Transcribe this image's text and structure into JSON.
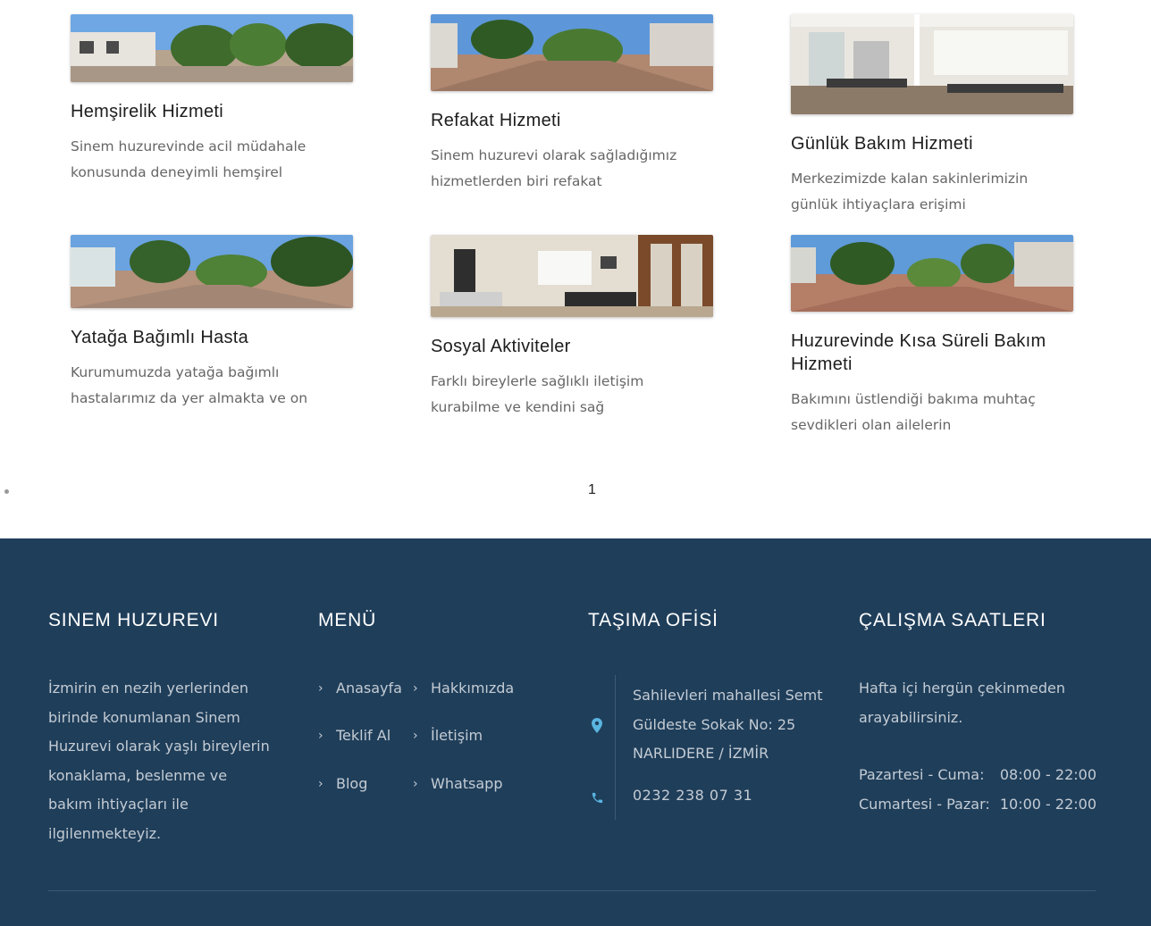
{
  "services": [
    {
      "title": "Hemşirelik Hizmeti",
      "desc": "Sinem huzurevinde acil müdahale konusunda deneyimli hemşirel"
    },
    {
      "title": "Refakat Hizmeti",
      "desc": "Sinem huzurevi olarak sağladığımız hizmetlerden biri refakat"
    },
    {
      "title": "Günlük Bakım Hizmeti",
      "desc": "Merkezimizde kalan sakinlerimizin günlük ihtiyaçlara erişimi"
    },
    {
      "title": "Yatağa Bağımlı Hasta",
      "desc": "Kurumumuzda yatağa bağımlı hastalarımız da yer almakta ve on"
    },
    {
      "title": "Sosyal Aktiviteler",
      "desc": "Farklı bireylerle sağlıklı iletişim kurabilme ve kendini sağ"
    },
    {
      "title": "Huzurevinde Kısa Süreli Bakım Hizmeti",
      "desc": "Bakımını üstlendiği bakıma muhtaç sevdikleri olan ailelerin"
    }
  ],
  "pagination": {
    "current": "1"
  },
  "footer": {
    "about": {
      "title": "SINEM HUZUREVI",
      "text": "İzmirin en nezih yerlerinden birinde konumlanan Sinem Huzurevi olarak yaşlı bireylerin konaklama, beslenme ve bakım ihtiyaçları ile ilgilenmekteyiz."
    },
    "menu": {
      "title": "MENÜ",
      "items": [
        "Anasayfa",
        "Hakkımızda",
        "Teklif Al",
        "İletişim",
        "Blog",
        "Whatsapp"
      ]
    },
    "office": {
      "title": "TAŞIMA OFİSİ",
      "address": "Sahilevleri mahallesi Semt Güldeste Sokak No: 25 NARLIDERE / İZMİR",
      "phone": "0232 238 07 31",
      "icons": [
        "map-pin-icon",
        "phone-icon"
      ]
    },
    "hours": {
      "title": "ÇALIŞMA SAATLERI",
      "intro": "Hafta içi hergün çekinmeden arayabilirsiniz.",
      "rows": [
        {
          "day": "Pazartesi - Cuma:",
          "time": "08:00 - 22:00"
        },
        {
          "day": "Cumartesi - Pazar:",
          "time": "10:00 - 22:00"
        }
      ]
    }
  },
  "colors": {
    "footer_bg": "#1f3e5a",
    "accent_icon": "#5ab4e0"
  }
}
